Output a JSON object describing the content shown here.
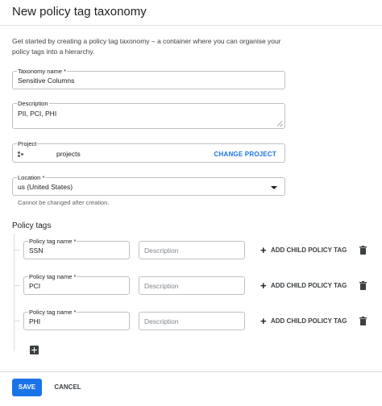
{
  "dialog": {
    "title": "New policy tag taxonomy",
    "intro": "Get started by creating a policy tag taxonomy – a container where you can organise your policy tags into a hierarchy."
  },
  "form": {
    "taxonomy_name": {
      "label": "Taxonomy name *",
      "value": "Sensitive Columns"
    },
    "description": {
      "label": "Description",
      "value": "PII, PCI, PHI"
    },
    "project": {
      "label": "Project",
      "value": "projects",
      "action": "CHANGE PROJECT"
    },
    "location": {
      "label": "Location *",
      "value": "us (United States)",
      "hint": "Cannot be changed after creation."
    }
  },
  "policy_tags": {
    "title": "Policy tags",
    "items": [
      {
        "name_label": "Policy tag name *",
        "name_value": "SSN",
        "description_placeholder": "Description",
        "add_child_label": "ADD CHILD POLICY TAG"
      },
      {
        "name_label": "Policy tag name *",
        "name_value": "PCI",
        "description_placeholder": "Description",
        "add_child_label": "ADD CHILD POLICY TAG"
      },
      {
        "name_label": "Policy tag name *",
        "name_value": "PHI",
        "description_placeholder": "Description",
        "add_child_label": "ADD CHILD POLICY TAG"
      }
    ]
  },
  "footer": {
    "save": "SAVE",
    "cancel": "CANCEL"
  },
  "colors": {
    "accent": "#1a73e8",
    "border": "#dadce0",
    "text": "#202124"
  },
  "icons": {
    "project": "project-icon",
    "dropdown": "arrow-drop-down-icon",
    "add": "plus-icon",
    "delete": "trash-icon",
    "add_tag": "add-box-icon"
  }
}
